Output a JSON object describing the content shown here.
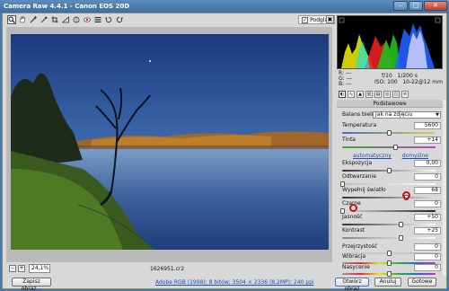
{
  "window": {
    "title": "Camera Raw 4.4.1  -  Canon EOS 20D",
    "minimize": "–",
    "maximize": "□",
    "close": "✕"
  },
  "toolbar": {
    "tools": [
      {
        "name": "zoom-tool-icon",
        "glyph": "🔍"
      },
      {
        "name": "hand-tool-icon",
        "glyph": "✋"
      },
      {
        "name": "white-balance-tool-icon",
        "glyph": "⁄"
      },
      {
        "name": "color-sampler-tool-icon",
        "glyph": "✎"
      },
      {
        "name": "crop-tool-icon",
        "glyph": "⌗"
      },
      {
        "name": "straighten-tool-icon",
        "glyph": "⊿"
      },
      {
        "name": "retouch-tool-icon",
        "glyph": "⊙"
      },
      {
        "name": "red-eye-tool-icon",
        "glyph": "◉"
      },
      {
        "name": "preferences-icon",
        "glyph": "☰"
      },
      {
        "name": "rotate-left-icon",
        "glyph": "↺"
      },
      {
        "name": "rotate-right-icon",
        "glyph": "↻"
      }
    ],
    "preview_label": "Podgląd",
    "preview_checked": "✓"
  },
  "image": {
    "zoom_minus": "–",
    "zoom_plus": "+",
    "zoom_value": "24,1%",
    "filename": "1626951.cr2"
  },
  "readouts": {
    "r": "R:",
    "g": "G:",
    "b": "B:",
    "r_val": "---",
    "g_val": "---",
    "b_val": "---",
    "aperture": "f/10",
    "shutter": "1/200 s",
    "iso": "ISO: 100",
    "lens": "10-22@12 mm"
  },
  "panel": {
    "title": "Podstawowe",
    "white_balance_label": "Balans bieli:",
    "white_balance_value": "Jak na zdjęciu",
    "auto_link": "automatyczny",
    "default_link": "domyślne",
    "sliders": {
      "temperature": {
        "label": "Temperatura",
        "value": "5600",
        "level": 0.5
      },
      "tint": {
        "label": "Tinta",
        "value": "+14",
        "level": 0.57
      },
      "exposure": {
        "label": "Ekspozycja",
        "value": "0,00",
        "level": 0.5
      },
      "recovery": {
        "label": "Odtwarzanie",
        "value": "0",
        "level": 0.0
      },
      "fill_light": {
        "label": "Wypełnij światło",
        "value": "68",
        "level": 0.68
      },
      "blacks": {
        "label": "Czarne",
        "value": "0",
        "level": 0.0
      },
      "brightness": {
        "label": "Jasność",
        "value": "+50",
        "level": 0.625
      },
      "contrast": {
        "label": "Kontrast",
        "value": "+25",
        "level": 0.625
      },
      "clarity": {
        "label": "Przejrzystość",
        "value": "0",
        "level": 0.5
      },
      "vibrance": {
        "label": "Wibracja",
        "value": "0",
        "level": 0.5
      },
      "saturation": {
        "label": "Nasycenie",
        "value": "0",
        "level": 0.5
      }
    }
  },
  "bottom": {
    "save_button": "Zapisz obraz...",
    "info_link": "Adobe RGB (1998); 8 bitów; 3504 × 2336 (8,2MP); 240 ppi",
    "open_button": "Otwórz obraz",
    "cancel_button": "Anuluj",
    "done_button": "Gotowe"
  },
  "colors": {
    "accent": "#1a4fc0",
    "highlight_ring": "#d01010"
  }
}
